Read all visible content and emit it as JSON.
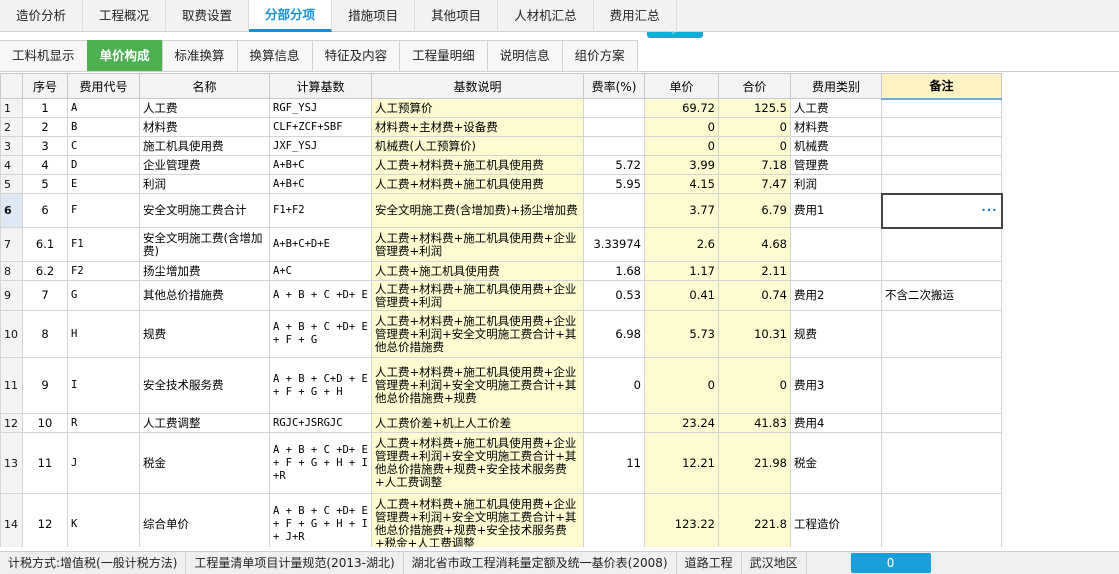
{
  "top_tabs": [
    "造价分析",
    "工程概况",
    "取费设置",
    "分部分项",
    "措施项目",
    "其他项目",
    "人材机汇总",
    "费用汇总"
  ],
  "active_top_tab": 3,
  "sub_tabs": [
    "工料机显示",
    "单价构成",
    "标准换算",
    "换算信息",
    "特征及内容",
    "工程量明细",
    "说明信息",
    "组价方案"
  ],
  "active_sub_tab": 1,
  "columns": [
    "序号",
    "费用代号",
    "名称",
    "计算基数",
    "基数说明",
    "费率(%)",
    "单价",
    "合价",
    "费用类别",
    "备注"
  ],
  "rows": [
    {
      "rn": "1",
      "seq": "1",
      "code": "A",
      "name": "人工费",
      "basis": "RGF_YSJ",
      "desc": "人工预算价",
      "rate": "",
      "price": "69.72",
      "total": "125.5",
      "cat": "人工费",
      "note": ""
    },
    {
      "rn": "2",
      "seq": "2",
      "code": "B",
      "name": "材料费",
      "basis": "CLF+ZCF+SBF",
      "desc": "材料费+主材费+设备费",
      "rate": "",
      "price": "0",
      "total": "0",
      "cat": "材料费",
      "note": ""
    },
    {
      "rn": "3",
      "seq": "3",
      "code": "C",
      "name": "施工机具使用费",
      "basis": "JXF_YSJ",
      "desc": "机械费(人工预算价)",
      "rate": "",
      "price": "0",
      "total": "0",
      "cat": "机械费",
      "note": ""
    },
    {
      "rn": "4",
      "seq": "4",
      "code": "D",
      "name": "企业管理费",
      "basis": "A+B+C",
      "desc": "人工费+材料费+施工机具使用费",
      "rate": "5.72",
      "price": "3.99",
      "total": "7.18",
      "cat": "管理费",
      "note": ""
    },
    {
      "rn": "5",
      "seq": "5",
      "code": "E",
      "name": "利润",
      "basis": "A+B+C",
      "desc": "人工费+材料费+施工机具使用费",
      "rate": "5.95",
      "price": "4.15",
      "total": "7.47",
      "cat": "利润",
      "note": ""
    },
    {
      "rn": "6",
      "seq": "6",
      "code": "F",
      "name": "安全文明施工费合计",
      "basis": "F1+F2",
      "desc": "安全文明施工费(含增加费)+扬尘增加费",
      "rate": "",
      "price": "3.77",
      "total": "6.79",
      "cat": "费用1",
      "note": "",
      "selected": true
    },
    {
      "rn": "7",
      "seq": "6.1",
      "code": "F1",
      "name": "安全文明施工费(含增加费)",
      "basis": "A+B+C+D+E",
      "desc": "人工费+材料费+施工机具使用费+企业管理费+利润",
      "rate": "3.33974",
      "price": "2.6",
      "total": "4.68",
      "cat": "",
      "note": ""
    },
    {
      "rn": "8",
      "seq": "6.2",
      "code": "F2",
      "name": "扬尘增加费",
      "basis": "A+C",
      "desc": "人工费+施工机具使用费",
      "rate": "1.68",
      "price": "1.17",
      "total": "2.11",
      "cat": "",
      "note": ""
    },
    {
      "rn": "9",
      "seq": "7",
      "code": "G",
      "name": "其他总价措施费",
      "basis": "A + B + C +D+ E",
      "desc": "人工费+材料费+施工机具使用费+企业管理费+利润",
      "rate": "0.53",
      "price": "0.41",
      "total": "0.74",
      "cat": "费用2",
      "note": "不含二次搬运"
    },
    {
      "rn": "10",
      "seq": "8",
      "code": "H",
      "name": "规费",
      "basis": "A + B + C +D+ E + F + G",
      "desc": "人工费+材料费+施工机具使用费+企业管理费+利润+安全文明施工费合计+其他总价措施费",
      "rate": "6.98",
      "price": "5.73",
      "total": "10.31",
      "cat": "规费",
      "note": ""
    },
    {
      "rn": "11",
      "seq": "9",
      "code": "I",
      "name": "安全技术服务费",
      "basis": "A + B + C+D + E + F + G + H",
      "desc": "人工费+材料费+施工机具使用费+企业管理费+利润+安全文明施工费合计+其他总价措施费+规费",
      "rate": "0",
      "price": "0",
      "total": "0",
      "cat": "费用3",
      "note": ""
    },
    {
      "rn": "12",
      "seq": "10",
      "code": "R",
      "name": "人工费调整",
      "basis": "RGJC+JSRGJC",
      "desc": "人工费价差+机上人工价差",
      "rate": "",
      "price": "23.24",
      "total": "41.83",
      "cat": "费用4",
      "note": ""
    },
    {
      "rn": "13",
      "seq": "11",
      "code": "J",
      "name": "税金",
      "basis": "A + B + C +D+ E + F + G + H + I +R",
      "desc": "人工费+材料费+施工机具使用费+企业管理费+利润+安全文明施工费合计+其他总价措施费+规费+安全技术服务费+人工费调整",
      "rate": "11",
      "price": "12.21",
      "total": "21.98",
      "cat": "税金",
      "note": ""
    },
    {
      "rn": "14",
      "seq": "12",
      "code": "K",
      "name": "综合单价",
      "basis": "A + B + C +D+ E + F  + G + H + I + J+R",
      "desc": "人工费+材料费+施工机具使用费+企业管理费+利润+安全文明施工费合计+其他总价措施费+规费+安全技术服务费+税金+人工费调整",
      "rate": "",
      "price": "123.22",
      "total": "221.8",
      "cat": "工程造价",
      "note": ""
    }
  ],
  "status": {
    "tax_method": "计税方式:增值税(一般计税方法)",
    "spec": "工程量清单项目计量规范(2013-湖北)",
    "quota": "湖北省市政工程消耗量定额及统一基价表(2008)",
    "project": "道路工程",
    "region": "武汉地区",
    "count": "0"
  }
}
